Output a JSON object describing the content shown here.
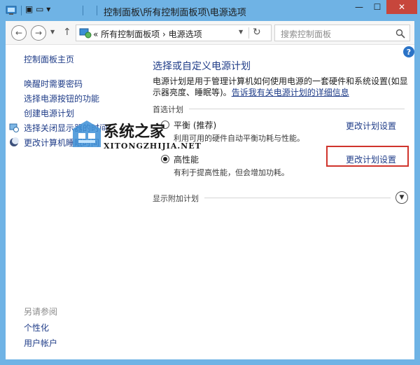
{
  "window": {
    "title": "控制面板\\所有控制面板项\\电源选项"
  },
  "nav": {
    "address": "«  所有控制面板项  ›  电源选项",
    "search_placeholder": "搜索控制面板"
  },
  "sidebar": {
    "home": "控制面板主页",
    "items": [
      "唤醒时需要密码",
      "选择电源按钮的功能",
      "创建电源计划",
      "选择关闭显示器的时间",
      "更改计算机睡眠时间"
    ],
    "see_also": "另请参阅",
    "see_also_items": [
      "个性化",
      "用户帐户"
    ]
  },
  "main": {
    "title": "选择或自定义电源计划",
    "desc_before": "电源计划是用于管理计算机如何使用电源的一套硬件和系统设置(如显示器亮度、睡眠等)。",
    "desc_link": "告诉我有关电源计划的详细信息",
    "preferred_label": "首选计划",
    "plans": [
      {
        "name": "平衡 (推荐)",
        "desc": "利用可用的硬件自动平衡功耗与性能。",
        "link": "更改计划设置",
        "selected": false
      },
      {
        "name": "高性能",
        "desc": "有利于提高性能，但会增加功耗。",
        "link": "更改计划设置",
        "selected": true
      }
    ],
    "extra_label": "显示附加计划"
  },
  "watermark": {
    "title": "系统之家",
    "subtitle": "XITONGZHIJIA.NET"
  }
}
